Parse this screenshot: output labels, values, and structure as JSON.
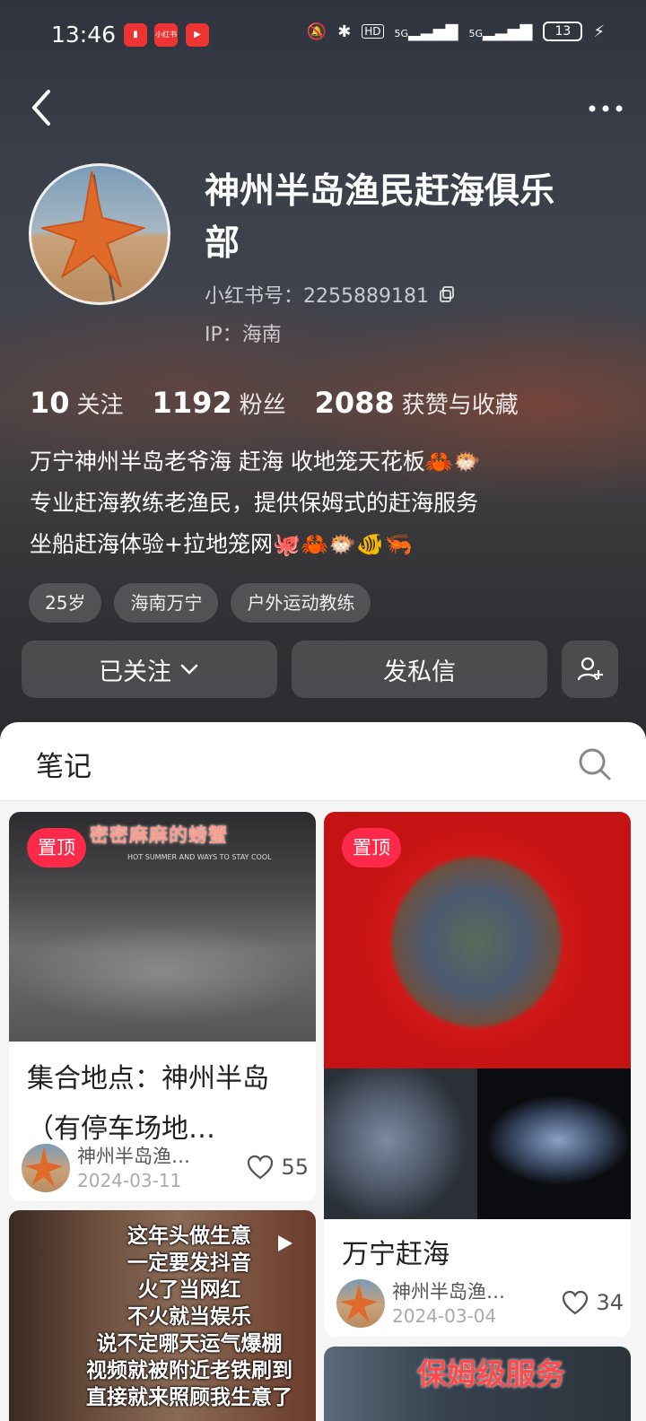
{
  "status_bar": {
    "time": "13:46",
    "app_icons": [
      "gift-app",
      "xiaohongshu-app",
      "video-app"
    ],
    "hd": "HD",
    "signal1": "5G",
    "signal2": "5G",
    "battery": "13"
  },
  "profile": {
    "name": "神州半岛渔民赶海俱乐部",
    "red_id_label": "小红书号：",
    "red_id": "2255889181",
    "ip": "IP：海南",
    "stats": [
      {
        "num": "10",
        "label": "关注"
      },
      {
        "num": "1192",
        "label": "粉丝"
      },
      {
        "num": "2088",
        "label": "获赞与收藏"
      }
    ],
    "bio": [
      "万宁神州半岛老爷海 赶海 收地笼天花板🦀🐡",
      "专业赶海教练老渔民，提供保姆式的赶海服务",
      "坐船赶海体验+拉地笼网🐙🦀🐡🐠🦐"
    ],
    "tags": [
      "25岁",
      "海南万宁",
      "户外运动教练"
    ],
    "follow_button": "已关注",
    "message_button": "发私信"
  },
  "tabs": {
    "notes": "笔记"
  },
  "notes": [
    {
      "pinned": "置顶",
      "overlay_text": "密密麻麻的螃蟹",
      "overlay_sub": "HOT SUMMER AND WAYS TO STAY COOL",
      "title": "集合地点：神州半岛（有停车场地…",
      "author": "神州半岛渔…",
      "date": "2024-03-11",
      "likes": "55"
    },
    {
      "pinned": "置顶",
      "title": "万宁赶海",
      "author": "神州半岛渔…",
      "date": "2024-03-04",
      "likes": "34"
    },
    {
      "overlay_lines": [
        "这年头做生意",
        "一定要发抖音",
        "火了当网红",
        "不火就当娱乐",
        "说不定哪天运气爆棚",
        "视频就被附近老铁刷到",
        "直接就来照顾我生意了"
      ]
    },
    {
      "overlay_text": "保姆级服务"
    }
  ],
  "colors": {
    "pin_red": "#ff2a4a",
    "header_dark": "#3a3f4a"
  }
}
